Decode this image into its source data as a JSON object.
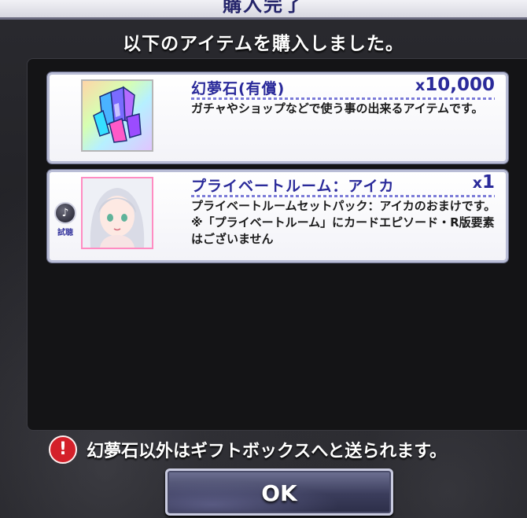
{
  "dialog": {
    "title": "購入完了",
    "message": "以下のアイテムを購入しました。"
  },
  "items": [
    {
      "name": "幻夢石(有償)",
      "qty_prefix": "x",
      "qty": "10,000",
      "description": "ガチャやショップなどで使う事の出来るアイテムです。",
      "icon": "crystal-icon"
    },
    {
      "name": "プライベートルーム：アイカ",
      "qty_prefix": "x",
      "qty": "1",
      "description": "プライベートルームセットパック：アイカのおまけです。※「プライベートルーム」にカードエピソード・R版要素はございません",
      "icon": "character-portrait",
      "listen_label": "試聴"
    }
  ],
  "notice": {
    "icon": "!",
    "text": "幻夢石以外はギフトボックスへと送られます。"
  },
  "ok_button": {
    "label": "OK"
  },
  "colors": {
    "title_blue": "#2a2a9a",
    "panel_dark": "#141416",
    "notice_red": "#d4202a"
  }
}
